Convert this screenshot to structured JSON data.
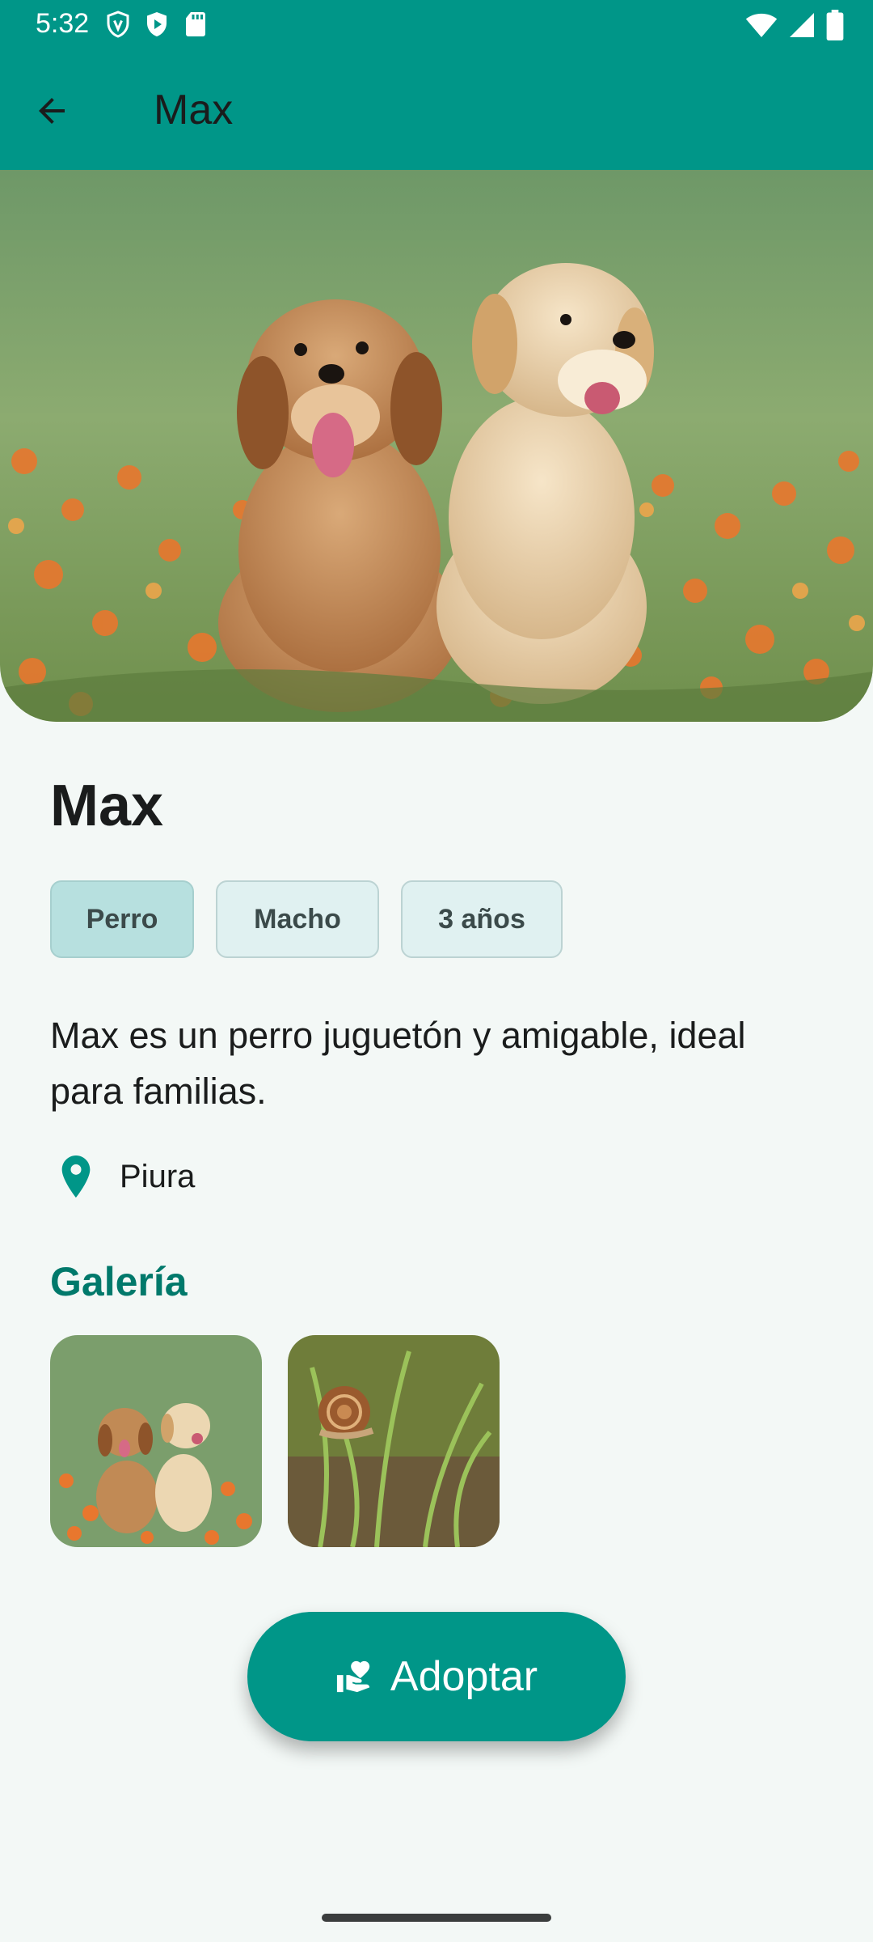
{
  "status_bar": {
    "time": "5:32",
    "icons": [
      "vpn-shield-icon",
      "play-protect-icon",
      "sd-card-icon",
      "wifi-icon",
      "cell-signal-icon",
      "battery-icon"
    ]
  },
  "app_bar": {
    "title": "Max",
    "back_icon": "arrow-back-icon"
  },
  "pet": {
    "name": "Max",
    "tags": [
      "Perro",
      "Macho",
      "3 años"
    ],
    "description": "Max es un perro juguetón y amigable, ideal para familias.",
    "location": "Piura",
    "location_icon": "location-pin-icon"
  },
  "gallery": {
    "title": "Galería",
    "images": [
      "two-puppies-photo",
      "snail-photo"
    ]
  },
  "adopt_button": {
    "label": "Adoptar",
    "icon": "volunteer-activism-icon"
  },
  "colors": {
    "primary": "#009688",
    "accent_text": "#00796b",
    "background": "#f3f8f6",
    "chip_selected": "#b7e0df",
    "chip": "#e0f1f1"
  }
}
